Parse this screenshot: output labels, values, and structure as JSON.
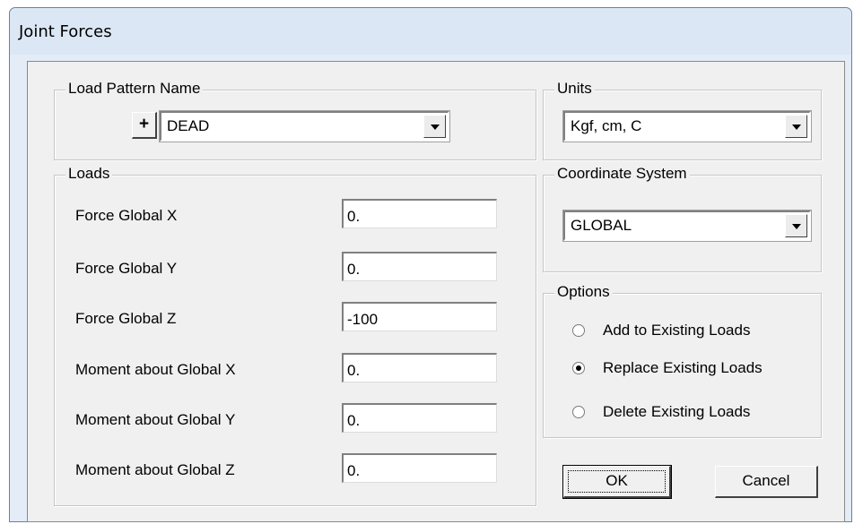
{
  "dialog": {
    "title": "Joint Forces"
  },
  "load_pattern": {
    "legend": "Load Pattern Name",
    "add_label": "+",
    "value": "DEAD"
  },
  "units": {
    "legend": "Units",
    "value": "Kgf, cm, C"
  },
  "coord_system": {
    "legend": "Coordinate System",
    "value": "GLOBAL"
  },
  "loads": {
    "legend": "Loads",
    "rows": [
      {
        "label": "Force Global X",
        "value": "0."
      },
      {
        "label": "Force Global Y",
        "value": "0."
      },
      {
        "label": "Force Global Z",
        "value": "-100"
      },
      {
        "label": "Moment about Global X",
        "value": "0."
      },
      {
        "label": "Moment about Global Y",
        "value": "0."
      },
      {
        "label": "Moment about Global Z",
        "value": "0."
      }
    ]
  },
  "options": {
    "legend": "Options",
    "selected": "Replace Existing Loads",
    "items": [
      {
        "label": "Add to Existing Loads",
        "checked": false
      },
      {
        "label": "Replace Existing Loads",
        "checked": true
      },
      {
        "label": "Delete Existing Loads",
        "checked": false
      }
    ]
  },
  "buttons": {
    "ok": "OK",
    "cancel": "Cancel"
  }
}
